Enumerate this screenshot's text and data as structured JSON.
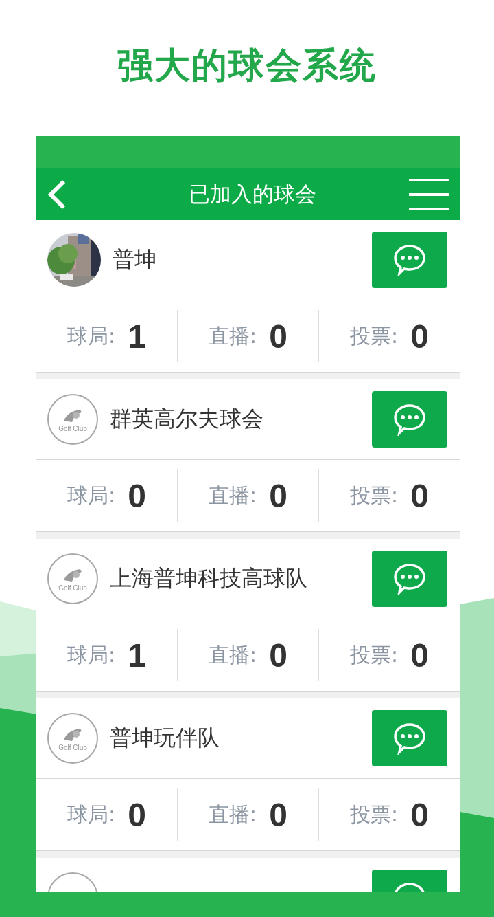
{
  "headline": "强大的球会系统",
  "nav": {
    "title": "已加入的球会"
  },
  "clubs": [
    {
      "name": "普坤",
      "stats": [
        {
          "label": "球局:",
          "value": "1"
        },
        {
          "label": "直播:",
          "value": "0"
        },
        {
          "label": "投票:",
          "value": "0"
        }
      ]
    },
    {
      "name": "群英高尔夫球会",
      "avatar": {
        "kind": "logo",
        "text": "Golf Club"
      },
      "stats": [
        {
          "label": "球局:",
          "value": "0"
        },
        {
          "label": "直播:",
          "value": "0"
        },
        {
          "label": "投票:",
          "value": "0"
        }
      ]
    },
    {
      "name": "上海普坤科技高球队",
      "avatar": {
        "kind": "logo",
        "text": "Golf Club"
      },
      "stats": [
        {
          "label": "球局:",
          "value": "1"
        },
        {
          "label": "直播:",
          "value": "0"
        },
        {
          "label": "投票:",
          "value": "0"
        }
      ]
    },
    {
      "name": "普坤玩伴队",
      "avatar": {
        "kind": "logo",
        "text": "Golf Club"
      },
      "stats": [
        {
          "label": "球局:",
          "value": "0"
        },
        {
          "label": "直播:",
          "value": "0"
        },
        {
          "label": "投票:",
          "value": "0"
        }
      ]
    },
    {
      "avatar": {
        "kind": "logo"
      }
    }
  ]
}
